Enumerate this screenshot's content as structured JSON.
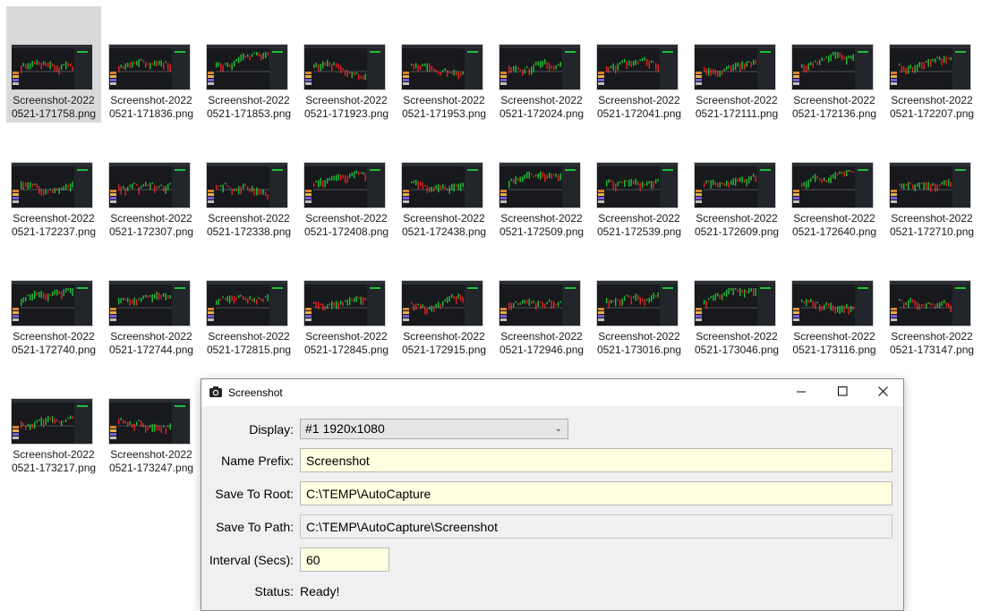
{
  "explorer": {
    "files": [
      {
        "line1": "Screenshot-2022",
        "line2": "0521-171758.png",
        "selected": true
      },
      {
        "line1": "Screenshot-2022",
        "line2": "0521-171836.png"
      },
      {
        "line1": "Screenshot-2022",
        "line2": "0521-171853.png"
      },
      {
        "line1": "Screenshot-2022",
        "line2": "0521-171923.png"
      },
      {
        "line1": "Screenshot-2022",
        "line2": "0521-171953.png"
      },
      {
        "line1": "Screenshot-2022",
        "line2": "0521-172024.png"
      },
      {
        "line1": "Screenshot-2022",
        "line2": "0521-172041.png"
      },
      {
        "line1": "Screenshot-2022",
        "line2": "0521-172111.png"
      },
      {
        "line1": "Screenshot-2022",
        "line2": "0521-172136.png"
      },
      {
        "line1": "Screenshot-2022",
        "line2": "0521-172207.png"
      },
      {
        "line1": "Screenshot-2022",
        "line2": "0521-172237.png"
      },
      {
        "line1": "Screenshot-2022",
        "line2": "0521-172307.png"
      },
      {
        "line1": "Screenshot-2022",
        "line2": "0521-172338.png"
      },
      {
        "line1": "Screenshot-2022",
        "line2": "0521-172408.png"
      },
      {
        "line1": "Screenshot-2022",
        "line2": "0521-172438.png"
      },
      {
        "line1": "Screenshot-2022",
        "line2": "0521-172509.png"
      },
      {
        "line1": "Screenshot-2022",
        "line2": "0521-172539.png"
      },
      {
        "line1": "Screenshot-2022",
        "line2": "0521-172609.png"
      },
      {
        "line1": "Screenshot-2022",
        "line2": "0521-172640.png"
      },
      {
        "line1": "Screenshot-2022",
        "line2": "0521-172710.png"
      },
      {
        "line1": "Screenshot-2022",
        "line2": "0521-172740.png"
      },
      {
        "line1": "Screenshot-2022",
        "line2": "0521-172744.png"
      },
      {
        "line1": "Screenshot-2022",
        "line2": "0521-172815.png"
      },
      {
        "line1": "Screenshot-2022",
        "line2": "0521-172845.png"
      },
      {
        "line1": "Screenshot-2022",
        "line2": "0521-172915.png"
      },
      {
        "line1": "Screenshot-2022",
        "line2": "0521-172946.png"
      },
      {
        "line1": "Screenshot-2022",
        "line2": "0521-173016.png"
      },
      {
        "line1": "Screenshot-2022",
        "line2": "0521-173046.png"
      },
      {
        "line1": "Screenshot-2022",
        "line2": "0521-173116.png"
      },
      {
        "line1": "Screenshot-2022",
        "line2": "0521-173147.png"
      },
      {
        "line1": "Screenshot-2022",
        "line2": "0521-173217.png"
      },
      {
        "line1": "Screenshot-2022",
        "line2": "0521-173247.png"
      }
    ],
    "thumbnail_icon": "trading-chart-thumbnail-icon",
    "colors": {
      "chart_bg": "#17191c",
      "candle_up": "#1fbf3a",
      "candle_down": "#e02424",
      "selection": "#d9d9d9"
    }
  },
  "dialog": {
    "title": "Screenshot",
    "icons": {
      "app": "camera-icon",
      "minimize": "minimize-icon",
      "maximize": "maximize-icon",
      "close": "close-icon"
    },
    "display_label": "Display:",
    "display_value": "#1 1920x1080",
    "name_prefix_label": "Name Prefix:",
    "name_prefix_value": "Screenshot",
    "save_root_label": "Save To Root:",
    "save_root_value": "C:\\TEMP\\AutoCapture",
    "save_path_label": "Save To Path:",
    "save_path_value": "C:\\TEMP\\AutoCapture\\Screenshot",
    "interval_label": "Interval (Secs):",
    "interval_value": "60",
    "status_label": "Status:",
    "status_value": "Ready!",
    "colors": {
      "input_bg": "#ffffe1",
      "dialog_bg": "#f0f0f0"
    }
  }
}
